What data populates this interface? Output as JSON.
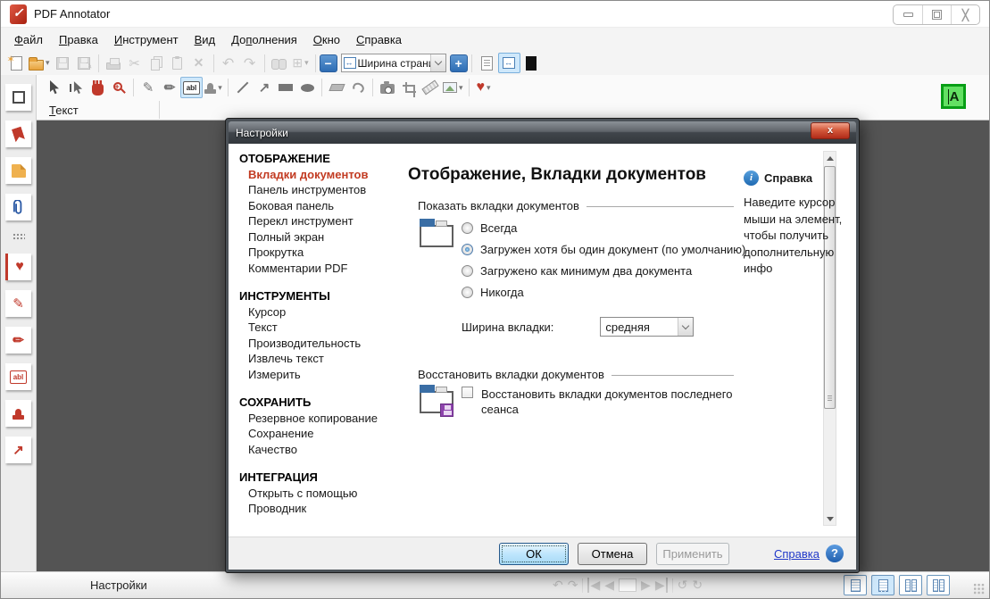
{
  "colors": {
    "accent_blue": "#2e6db4",
    "selected_nav_red": "#c23b22",
    "tool_red": "#c0392b",
    "selection_highlight": "#cfe8fb",
    "dialog_frame": "#4b5157",
    "doc_background": "#545454",
    "green_indicator": "#63e063"
  },
  "window": {
    "title": "PDF Annotator",
    "controls": [
      "minimize",
      "maximize",
      "close"
    ]
  },
  "menu": {
    "items": [
      {
        "label": "Файл",
        "m": 0
      },
      {
        "label": "Правка",
        "m": 0
      },
      {
        "label": "Инструмент",
        "m": 0
      },
      {
        "label": "Вид",
        "m": 0
      },
      {
        "label": "Дополнения",
        "m": 2
      },
      {
        "label": "Окно",
        "m": 0
      },
      {
        "label": "Справка",
        "m": 0
      }
    ]
  },
  "toolbar": {
    "zoom_value": "Ширина страни",
    "icons": [
      "new-document",
      "open",
      "save",
      "save-as",
      "print",
      "cut",
      "copy",
      "paste",
      "delete",
      "undo",
      "redo",
      "find",
      "snap-grid",
      "zoom-out",
      "zoom-level-select",
      "zoom-in",
      "fit-page",
      "fit-width",
      "fullscreen"
    ]
  },
  "tools": {
    "abl_label": "abl",
    "icons": [
      "select-cursor",
      "select-text-cursor",
      "pan-hand",
      "zoom-tool",
      "pen",
      "marker",
      "text-box",
      "stamp",
      "line",
      "arrow",
      "rectangle",
      "ellipse",
      "eraser",
      "lasso",
      "snapshot",
      "crop",
      "measure",
      "insert-image",
      "favorites"
    ]
  },
  "format_bar": {
    "label": {
      "label": "Текст",
      "m": 0
    }
  },
  "sidebar": {
    "abl_label": "abl",
    "icons": [
      "thumbnails",
      "bookmarks",
      "notes",
      "attachments",
      "favorite-heart",
      "pen",
      "marker",
      "text-box",
      "stamp",
      "arrow"
    ]
  },
  "green_indicator": {
    "label": "A"
  },
  "statusbar": {
    "left": "Настройки",
    "icons": [
      "rotate-page-left",
      "rotate-page-right",
      "first-page",
      "previous-page",
      "page-number",
      "next-page",
      "last-page",
      "history-back",
      "history-forward",
      "layout-single",
      "layout-continuous",
      "layout-facing",
      "layout-facing-continuous"
    ]
  },
  "dialog": {
    "title": "Настройки",
    "close_label": "x",
    "nav": {
      "sections": [
        {
          "header": "ОТОБРАЖЕНИЕ",
          "items": [
            "Вкладки документов",
            "Панель инструментов",
            "Боковая панель",
            "Перекл инструмент",
            "Полный экран",
            "Прокрутка",
            "Комментарии PDF"
          ]
        },
        {
          "header": "ИНСТРУМЕНТЫ",
          "items": [
            "Курсор",
            "Текст",
            "Производительность",
            "Извлечь текст",
            "Измерить"
          ]
        },
        {
          "header": "СОХРАНИТЬ",
          "items": [
            "Резервное копирование",
            "Сохранение",
            "Качество"
          ]
        },
        {
          "header": "ИНТЕГРАЦИЯ",
          "items": [
            "Открыть с помощью",
            "Проводник"
          ]
        }
      ],
      "selected": "Вкладки документов"
    },
    "content": {
      "title": "Отображение, Вкладки документов",
      "help": {
        "label": "Справка",
        "text": "Наведите курсор мыши на элемент, чтобы получить дополнительную инфо"
      },
      "show_tabs": {
        "label": "Показать вкладки документов",
        "options": [
          {
            "label": "Всегда",
            "checked": false
          },
          {
            "label": "Загружен хотя бы один документ (по умолчанию)",
            "checked": true
          },
          {
            "label": "Загружено как минимум два документа",
            "checked": false
          },
          {
            "label": "Никогда",
            "checked": false
          }
        ]
      },
      "tab_width": {
        "label": "Ширина вкладки:",
        "value": "средняя"
      },
      "restore": {
        "label": "Восстановить вкладки документов",
        "checkbox": {
          "label": "Восстановить вкладки документов последнего сеанса",
          "checked": false
        }
      }
    },
    "buttons": {
      "ok": "ОК",
      "cancel": "Отмена",
      "apply": "Применить",
      "help": {
        "label": "Справка",
        "m": 0
      }
    }
  }
}
